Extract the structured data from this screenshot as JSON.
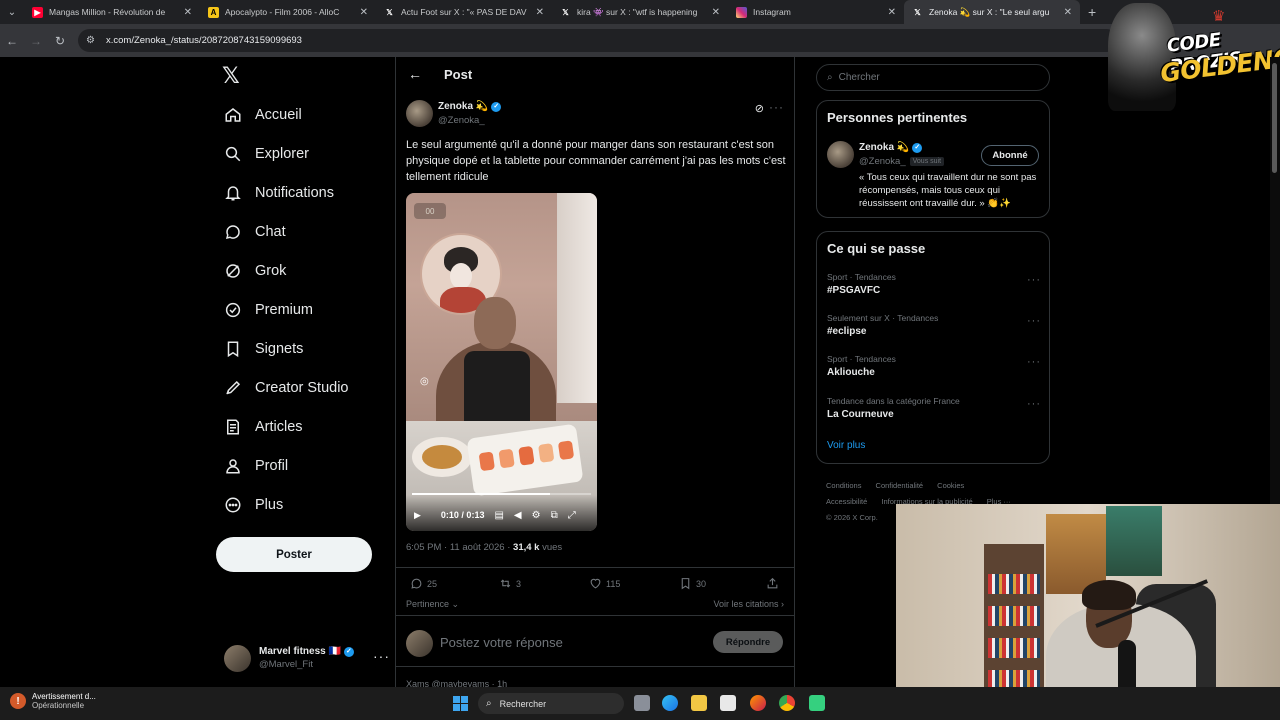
{
  "browser": {
    "tabs": [
      {
        "title": "Mangas Million - Révolution de",
        "favicon": "youtube",
        "color": "#ff0033",
        "active": false
      },
      {
        "title": "Apocalypto - Film 2006 - AlloC",
        "favicon": "allocine",
        "color": "#f5c518",
        "active": false
      },
      {
        "title": "Actu Foot sur X : \"« PAS DE DAV",
        "favicon": "x",
        "color": "#000000",
        "active": false
      },
      {
        "title": "kira 👾 sur X : \"wtf is happening",
        "favicon": "x",
        "color": "#000000",
        "active": false
      },
      {
        "title": "Instagram",
        "favicon": "instagram",
        "color": "#d62976",
        "active": false
      },
      {
        "title": "Zenoka 💫 sur X : \"Le seul argu",
        "favicon": "x",
        "color": "#000000",
        "active": true
      }
    ],
    "new_tab": "+",
    "url": "x.com/Zenoka_/status/2087208743159099693"
  },
  "nav": {
    "logo": "𝕏",
    "items": [
      {
        "label": "Accueil",
        "icon": "home-icon"
      },
      {
        "label": "Explorer",
        "icon": "search-icon"
      },
      {
        "label": "Notifications",
        "icon": "bell-icon"
      },
      {
        "label": "Chat",
        "icon": "chat-icon"
      },
      {
        "label": "Grok",
        "icon": "grok-icon"
      },
      {
        "label": "Premium",
        "icon": "premium-icon"
      },
      {
        "label": "Signets",
        "icon": "bookmark-icon"
      },
      {
        "label": "Creator Studio",
        "icon": "rocket-icon"
      },
      {
        "label": "Articles",
        "icon": "article-icon"
      },
      {
        "label": "Profil",
        "icon": "person-icon"
      },
      {
        "label": "Plus",
        "icon": "more-circle-icon"
      }
    ],
    "post_button": "Poster",
    "account": {
      "name": "Marvel fitness 🇫🇷",
      "handle": "@Marvel_Fit"
    }
  },
  "post": {
    "header_title": "Post",
    "author_name": "Zenoka 💫",
    "author_handle": "@Zenoka_",
    "text": "Le seul argumenté qu'il a donné pour manger dans son restaurant c'est son physique dopé et la tablette pour commander carrément j'ai pas les mots c'est tellement ridicule",
    "video": {
      "badge": "00",
      "time": "0:10 / 0:13",
      "progress": 0.77
    },
    "timestamp": "6:05 PM · 11 août 2026 · ",
    "views_count": "31,4 k",
    "views_label": " vues",
    "stats": {
      "replies": "25",
      "reposts": "3",
      "likes": "115",
      "bookmarks": "30"
    },
    "sort_label": "Pertinence ⌄",
    "quotes_link": "Voir les citations ›",
    "reply_placeholder": "Postez votre réponse",
    "reply_button": "Répondre",
    "next_reply_preview": "Xams @maybeyams · 1h"
  },
  "sidebar": {
    "search_placeholder": "Chercher",
    "relevant": {
      "title": "Personnes pertinentes",
      "name": "Zenoka 💫",
      "handle": "@Zenoka_",
      "follows_you": "Vous suit",
      "button": "Abonné",
      "bio": "« Tous ceux qui travaillent dur ne sont pas récompensés, mais tous ceux qui réussissent ont travaillé dur. » 👏✨"
    },
    "trends": {
      "title": "Ce qui se passe",
      "items": [
        {
          "context": "Sport · Tendances",
          "name": "#PSGAVFC"
        },
        {
          "context": "Seulement sur X · Tendances",
          "name": "#eclipse"
        },
        {
          "context": "Sport · Tendances",
          "name": "Akliouche"
        },
        {
          "context": "Tendance dans la catégorie France",
          "name": "La Courneuve"
        }
      ],
      "see_more": "Voir plus"
    },
    "footer": {
      "links": [
        "Conditions",
        "Confidentialité",
        "Cookies",
        "Accessibilité",
        "Informations sur la publicité",
        "Plus ···"
      ],
      "copyright": "© 2026 X Corp."
    }
  },
  "overlay": {
    "badge_line1": "CODE PROZIS",
    "badge_line2": "GOLDENG"
  },
  "taskbar": {
    "weather_title": "Avertissement d...",
    "weather_sub": "Opérationnelle",
    "search_label": "Rechercher"
  }
}
